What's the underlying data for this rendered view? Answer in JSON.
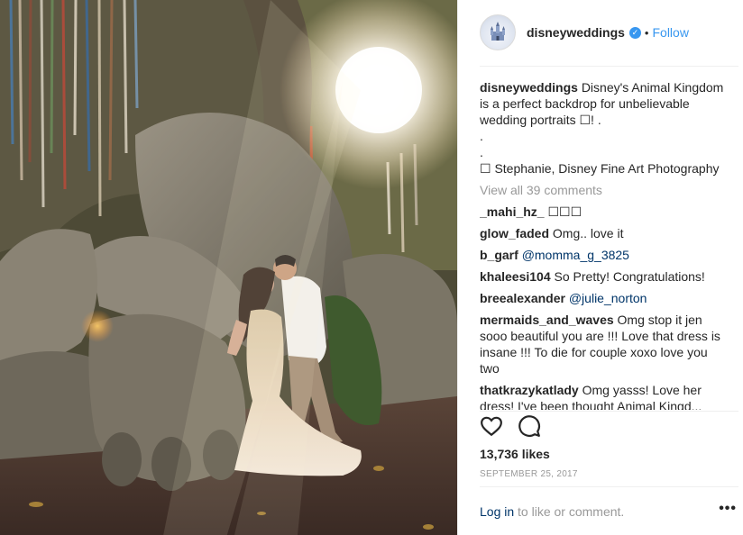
{
  "post": {
    "photo_alt": "",
    "username": "disneyweddings",
    "follow_label": "Follow",
    "separator": "•",
    "caption": {
      "user": "disneyweddings",
      "text": "Disney's Animal Kingdom is a perfect backdrop for unbelievable wedding portraits ☐! .",
      "dot1": ".",
      "dot2": ".",
      "credit": "☐ Stephanie, Disney Fine Art Photography"
    },
    "view_all": "View all 39 comments",
    "comments": [
      {
        "user": "_mahi_hz_",
        "text": "☐☐☐"
      },
      {
        "user": "glow_faded",
        "text": "Omg.. love it"
      },
      {
        "user": "b_garf",
        "text": "@momma_g_3825"
      },
      {
        "user": "khaleesi104",
        "text": "So Pretty! Congratulations!"
      },
      {
        "user": "breealexander",
        "text": "@julie_norton"
      },
      {
        "user": "mermaids_and_waves",
        "text": "Omg stop it jen sooo beautiful you are !!! Love that dress is insane !!! To die for couple xoxo love you two"
      },
      {
        "user": "thatkrazykatlady",
        "text": "Omg yasss! Love her dress! I've been thought Animal Kingd..."
      }
    ],
    "likes": "13,736 likes",
    "date": "September 25, 2017",
    "footer": {
      "login": "Log in",
      "rest": " to like or comment."
    },
    "more": "•••"
  },
  "icons": {
    "heart": "heart-icon",
    "comment": "comment-icon",
    "verified": "verified-badge-icon",
    "more": "more-options-icon"
  },
  "colors": {
    "link": "#3897f0",
    "muted": "#999999",
    "text": "#262626",
    "mention": "#003569"
  }
}
